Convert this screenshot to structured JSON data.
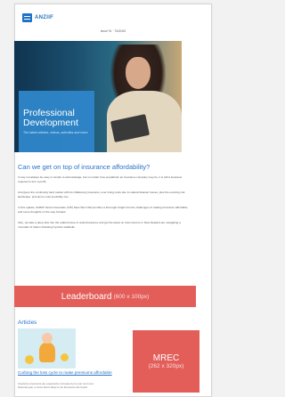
{
  "header": {
    "logo_text": "ANZIIF",
    "issue": "Issue 91 · TAGNIG"
  },
  "hero": {
    "title": "Professional Development",
    "subtitle": "The latest articles, videos, activities and more"
  },
  "main": {
    "headline": "Can we get on top of insurance affordability?",
    "paragraphs": [
      "It may not always be easy or simple to acknowledge, but no matter how empathetic an insurance company may be, it is still a business required to turn a profit.",
      "And given the continuing hard market with its inflationary pressures, ever rising costs due to natural disaster losses, plus the evolving risk landscape, premiums must inevitably rise.",
      "In this update, ANZIIF Senior Associate (CIP) Siew Wei Chai provides a thorough insight into the challenges of making insurance affordable and some thoughts on the way forward.",
      "Also, we take a deep dive into the related issue of underinsurance and get the latest on how insurers in New Zealand are navigating a mountain of claims following Cyclone Gabrielle."
    ]
  },
  "leaderboard": {
    "label": "Leaderboard",
    "size": "(600 x 100px)"
  },
  "articles": {
    "title": "Articles",
    "items": [
      {
        "link": "Curbing the loss cycle to make premiums affordable",
        "excerpt": "Insurance premiums are expected to increase by ten per cent next financial year, a move that is likely to be felt across the board"
      }
    ]
  },
  "mrec": {
    "label": "MREC",
    "size": "(262 x 320px)"
  },
  "colors": {
    "accent": "#2a72c7",
    "ad_red": "#e35d59",
    "hero_banner": "#2e86c9"
  }
}
